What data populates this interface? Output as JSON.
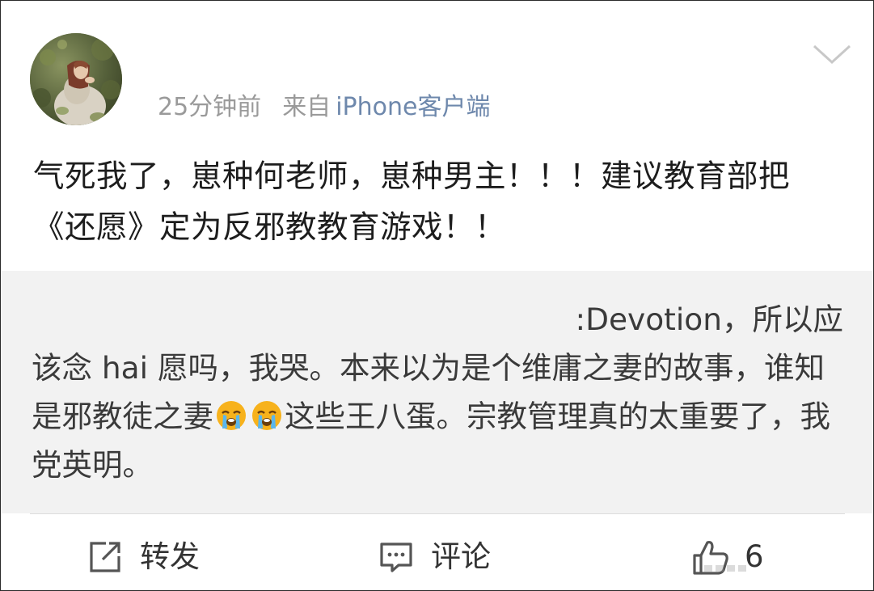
{
  "post": {
    "time": "25分钟前",
    "from_prefix": "来自",
    "client": "iPhone客户端",
    "text": "气死我了，崽种何老师，崽种男主！！！建议教育部把《还愿》定为反邪教教育游戏！！"
  },
  "repost": {
    "line1": ":Devotion，所以应",
    "text_before_emoji": "该念 hai 愿吗，我哭。本来以为是个维庸之妻的故事，谁知是邪教徒之妻",
    "emoji": [
      "crying-face",
      "crying-face"
    ],
    "text_after_emoji": "这些王八蛋。宗教管理真的太重要了，我党英明。"
  },
  "actions": {
    "repost_label": "转发",
    "comment_label": "评论",
    "like_count": "6"
  },
  "colors": {
    "link": "#6e88ac",
    "meta": "#9a9a9a",
    "repost_bg": "#f2f2f2",
    "emoji": "#f7b21c"
  },
  "icons": {
    "menu": "chevron-down-icon",
    "repost": "share-icon",
    "comment": "comment-icon",
    "like": "thumbs-up-icon"
  }
}
